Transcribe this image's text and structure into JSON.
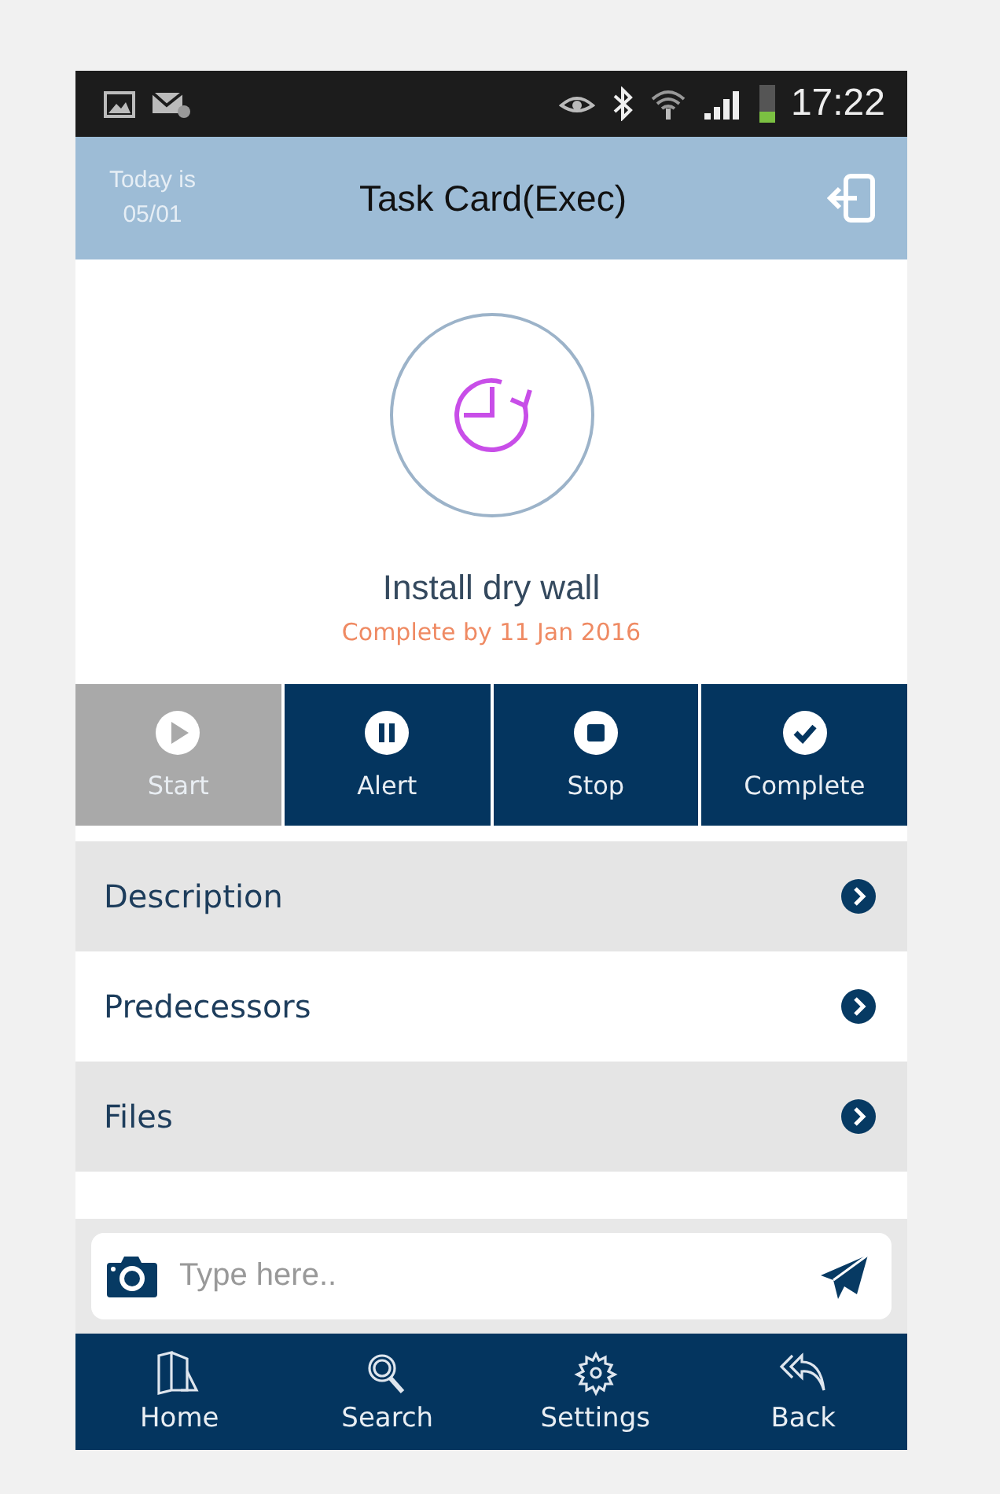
{
  "status_bar": {
    "time": "17:22"
  },
  "header": {
    "date_label": "Today is",
    "date": "05/01",
    "title": "Task Card(Exec)"
  },
  "task": {
    "name": "Install dry wall",
    "due": "Complete by 11 Jan 2016"
  },
  "actions": [
    {
      "label": "Start",
      "disabled": true
    },
    {
      "label": "Alert",
      "disabled": false
    },
    {
      "label": "Stop",
      "disabled": false
    },
    {
      "label": "Complete",
      "disabled": false
    }
  ],
  "sections": [
    {
      "label": "Description"
    },
    {
      "label": "Predecessors"
    },
    {
      "label": "Files"
    }
  ],
  "message": {
    "placeholder": "Type here.."
  },
  "nav": [
    {
      "label": "Home"
    },
    {
      "label": "Search"
    },
    {
      "label": "Settings"
    },
    {
      "label": "Back"
    }
  ]
}
